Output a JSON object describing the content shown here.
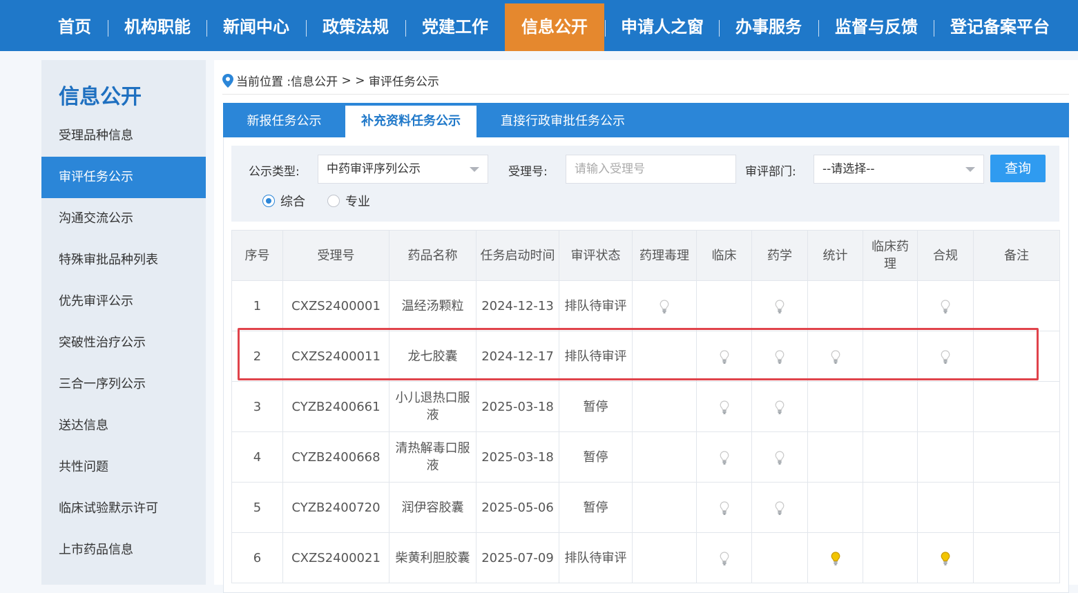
{
  "nav": {
    "items": [
      {
        "label": "首页"
      },
      {
        "label": "机构职能"
      },
      {
        "label": "新闻中心"
      },
      {
        "label": "政策法规"
      },
      {
        "label": "党建工作"
      },
      {
        "label": "信息公开",
        "active": true
      },
      {
        "label": "申请人之窗"
      },
      {
        "label": "办事服务"
      },
      {
        "label": "监督与反馈"
      },
      {
        "label": "登记备案平台"
      }
    ]
  },
  "sidebar": {
    "title": "信息公开",
    "items": [
      {
        "label": "受理品种信息"
      },
      {
        "label": "审评任务公示",
        "active": true
      },
      {
        "label": "沟通交流公示"
      },
      {
        "label": "特殊审批品种列表"
      },
      {
        "label": "优先审评公示"
      },
      {
        "label": "突破性治疗公示"
      },
      {
        "label": "三合一序列公示"
      },
      {
        "label": "送达信息"
      },
      {
        "label": "共性问题"
      },
      {
        "label": "临床试验默示许可"
      },
      {
        "label": "上市药品信息"
      }
    ]
  },
  "breadcrumb": {
    "prefix": "当前位置 : ",
    "section": "信息公开",
    "separator": " > > ",
    "current": "审评任务公示"
  },
  "tabs": [
    {
      "label": "新报任务公示"
    },
    {
      "label": "补充资料任务公示",
      "active": true
    },
    {
      "label": "直接行政审批任务公示"
    }
  ],
  "filter": {
    "type_label": "公示类型:",
    "type_value": "中药审评序列公示",
    "accept_label": "受理号:",
    "accept_placeholder": "请输入受理号",
    "dept_label": "审评部门:",
    "dept_value": "--请选择--",
    "query_label": "查询",
    "radio_general": "综合",
    "radio_special": "专业",
    "selected_radio": "综合"
  },
  "table": {
    "headers": [
      "序号",
      "受理号",
      "药品名称",
      "任务启动时间",
      "审评状态",
      "药理毒理",
      "临床",
      "药学",
      "统计",
      "临床药理",
      "合规",
      "备注"
    ],
    "rows": [
      {
        "no": "1",
        "id": "CXZS2400001",
        "name": "温经汤颗粒",
        "date": "2024-12-13",
        "status": "排队待审评",
        "bulbs": [
          "gray",
          "",
          "gray",
          "",
          "",
          "gray",
          ""
        ]
      },
      {
        "no": "2",
        "id": "CXZS2400011",
        "name": "龙七胶囊",
        "date": "2024-12-17",
        "status": "排队待审评",
        "bulbs": [
          "",
          "gray",
          "gray",
          "gray",
          "",
          "gray",
          ""
        ]
      },
      {
        "no": "3",
        "id": "CYZB2400661",
        "name": "小儿退热口服液",
        "date": "2025-03-18",
        "status": "暂停",
        "bulbs": [
          "",
          "gray",
          "gray",
          "",
          "",
          "",
          ""
        ]
      },
      {
        "no": "4",
        "id": "CYZB2400668",
        "name": "清热解毒口服液",
        "date": "2025-03-18",
        "status": "暂停",
        "bulbs": [
          "",
          "gray",
          "gray",
          "",
          "",
          "",
          ""
        ]
      },
      {
        "no": "5",
        "id": "CYZB2400720",
        "name": "润伊容胶囊",
        "date": "2025-05-06",
        "status": "暂停",
        "bulbs": [
          "",
          "gray",
          "gray",
          "",
          "",
          "",
          ""
        ]
      },
      {
        "no": "6",
        "id": "CXZS2400021",
        "name": "柴黄利胆胶囊",
        "date": "2025-07-09",
        "status": "排队待审评",
        "bulbs": [
          "",
          "gray",
          "",
          "yellow",
          "",
          "yellow",
          ""
        ]
      }
    ]
  },
  "colors": {
    "nav_bg": "#1f78c9",
    "nav_active": "#e5882e",
    "accent": "#2b86d8",
    "highlight": "#e0434b",
    "bulb_on": "#f2c500",
    "bulb_off": "#c9c9c9"
  }
}
